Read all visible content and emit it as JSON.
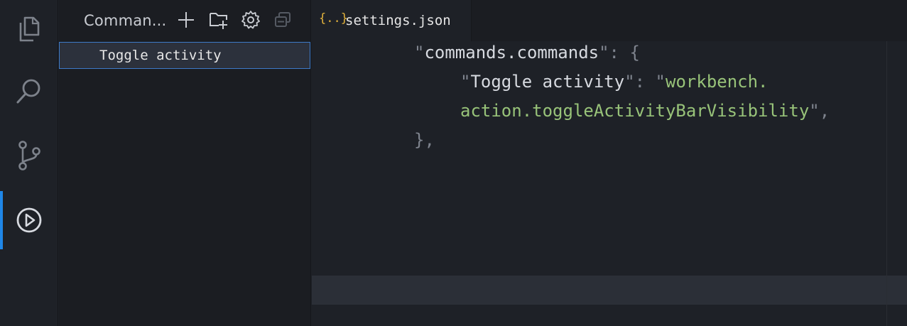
{
  "activity_bar": {
    "items": [
      {
        "name": "explorer",
        "icon": "files-icon"
      },
      {
        "name": "search",
        "icon": "search-icon"
      },
      {
        "name": "source-control",
        "icon": "source-control-icon"
      },
      {
        "name": "commands",
        "icon": "run-icon",
        "active": true
      }
    ],
    "accent_color": "#1f87e8"
  },
  "sidebar": {
    "title": "Comman...",
    "actions": [
      "add-icon",
      "new-folder-icon",
      "gear-icon",
      "collapse-all-icon"
    ],
    "tree": [
      {
        "label": "Toggle activity",
        "selected": true
      }
    ]
  },
  "editor": {
    "tab": {
      "icon_text": "{..}",
      "label": "settings.json"
    },
    "lines": [
      {
        "q1": "\"",
        "key": "commands.commands",
        "q2": "\"",
        "rest": ": {"
      },
      {
        "q1": "\"",
        "key": "Toggle activity",
        "q2": "\"",
        "sep": ": \"",
        "value": "workbench."
      },
      {
        "value": "action.toggleActivityBarVisibility",
        "end": "\","
      },
      {
        "close": "},"
      }
    ]
  }
}
